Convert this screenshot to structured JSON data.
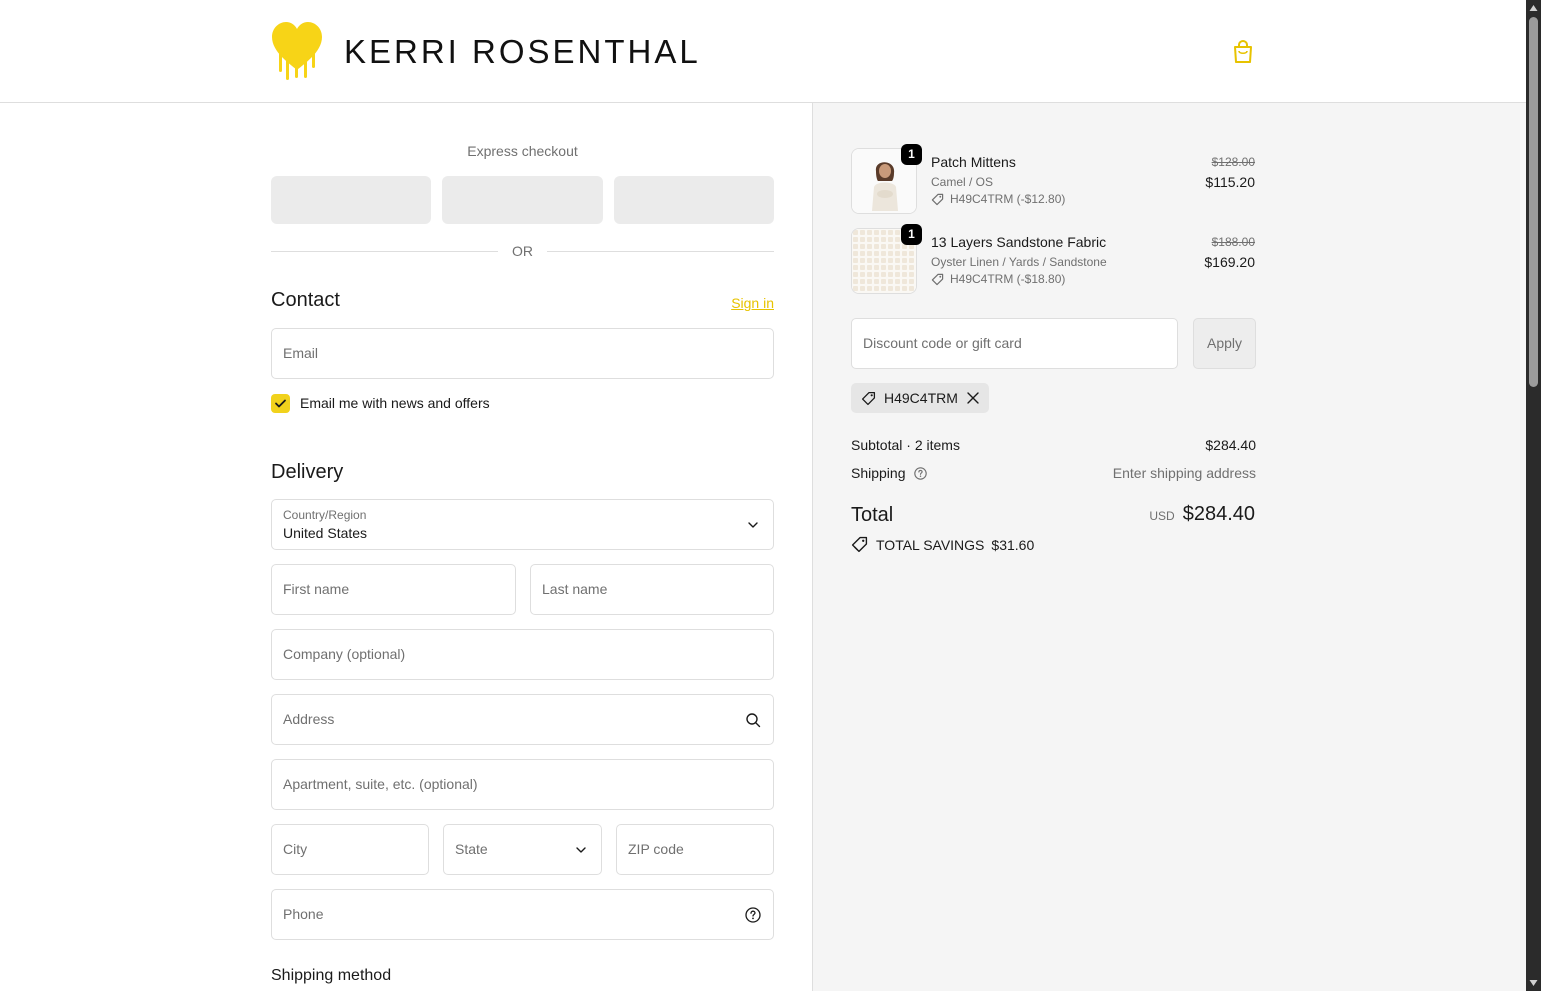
{
  "brand": {
    "name": "KERRI ROSENTHAL",
    "accent_color": "#f1d21c",
    "logo_icon": "dripping-heart-icon"
  },
  "header": {
    "cart_icon": "shopping-bag-icon"
  },
  "express": {
    "label": "Express checkout",
    "or_label": "OR"
  },
  "contact": {
    "title": "Contact",
    "sign_in": "Sign in",
    "email_placeholder": "Email",
    "newsletter_label": "Email me with news and offers",
    "newsletter_checked": true
  },
  "delivery": {
    "title": "Delivery",
    "country_label": "Country/Region",
    "country_value": "United States",
    "first_name": "First name",
    "last_name": "Last name",
    "company": "Company (optional)",
    "address": "Address",
    "apartment": "Apartment, suite, etc. (optional)",
    "city": "City",
    "state": "State",
    "zip": "ZIP code",
    "phone": "Phone"
  },
  "shipping_method": {
    "title": "Shipping method"
  },
  "cart": {
    "items": [
      {
        "quantity": "1",
        "name": "Patch Mittens",
        "variant": "Camel / OS",
        "discount": "H49C4TRM (-$12.80)",
        "original_price": "$128.00",
        "price": "$115.20"
      },
      {
        "quantity": "1",
        "name": "13 Layers Sandstone Fabric",
        "variant": "Oyster Linen / Yards / Sandstone",
        "discount": "H49C4TRM (-$18.80)",
        "original_price": "$188.00",
        "price": "$169.20"
      }
    ],
    "discount_placeholder": "Discount code or gift card",
    "apply_label": "Apply",
    "applied_code": "H49C4TRM",
    "subtotal_label": "Subtotal · 2 items",
    "subtotal_value": "$284.40",
    "shipping_label": "Shipping",
    "shipping_value": "Enter shipping address",
    "total_label": "Total",
    "total_currency": "USD",
    "total_value": "$284.40",
    "savings_label": "TOTAL SAVINGS",
    "savings_value": "$31.60"
  }
}
